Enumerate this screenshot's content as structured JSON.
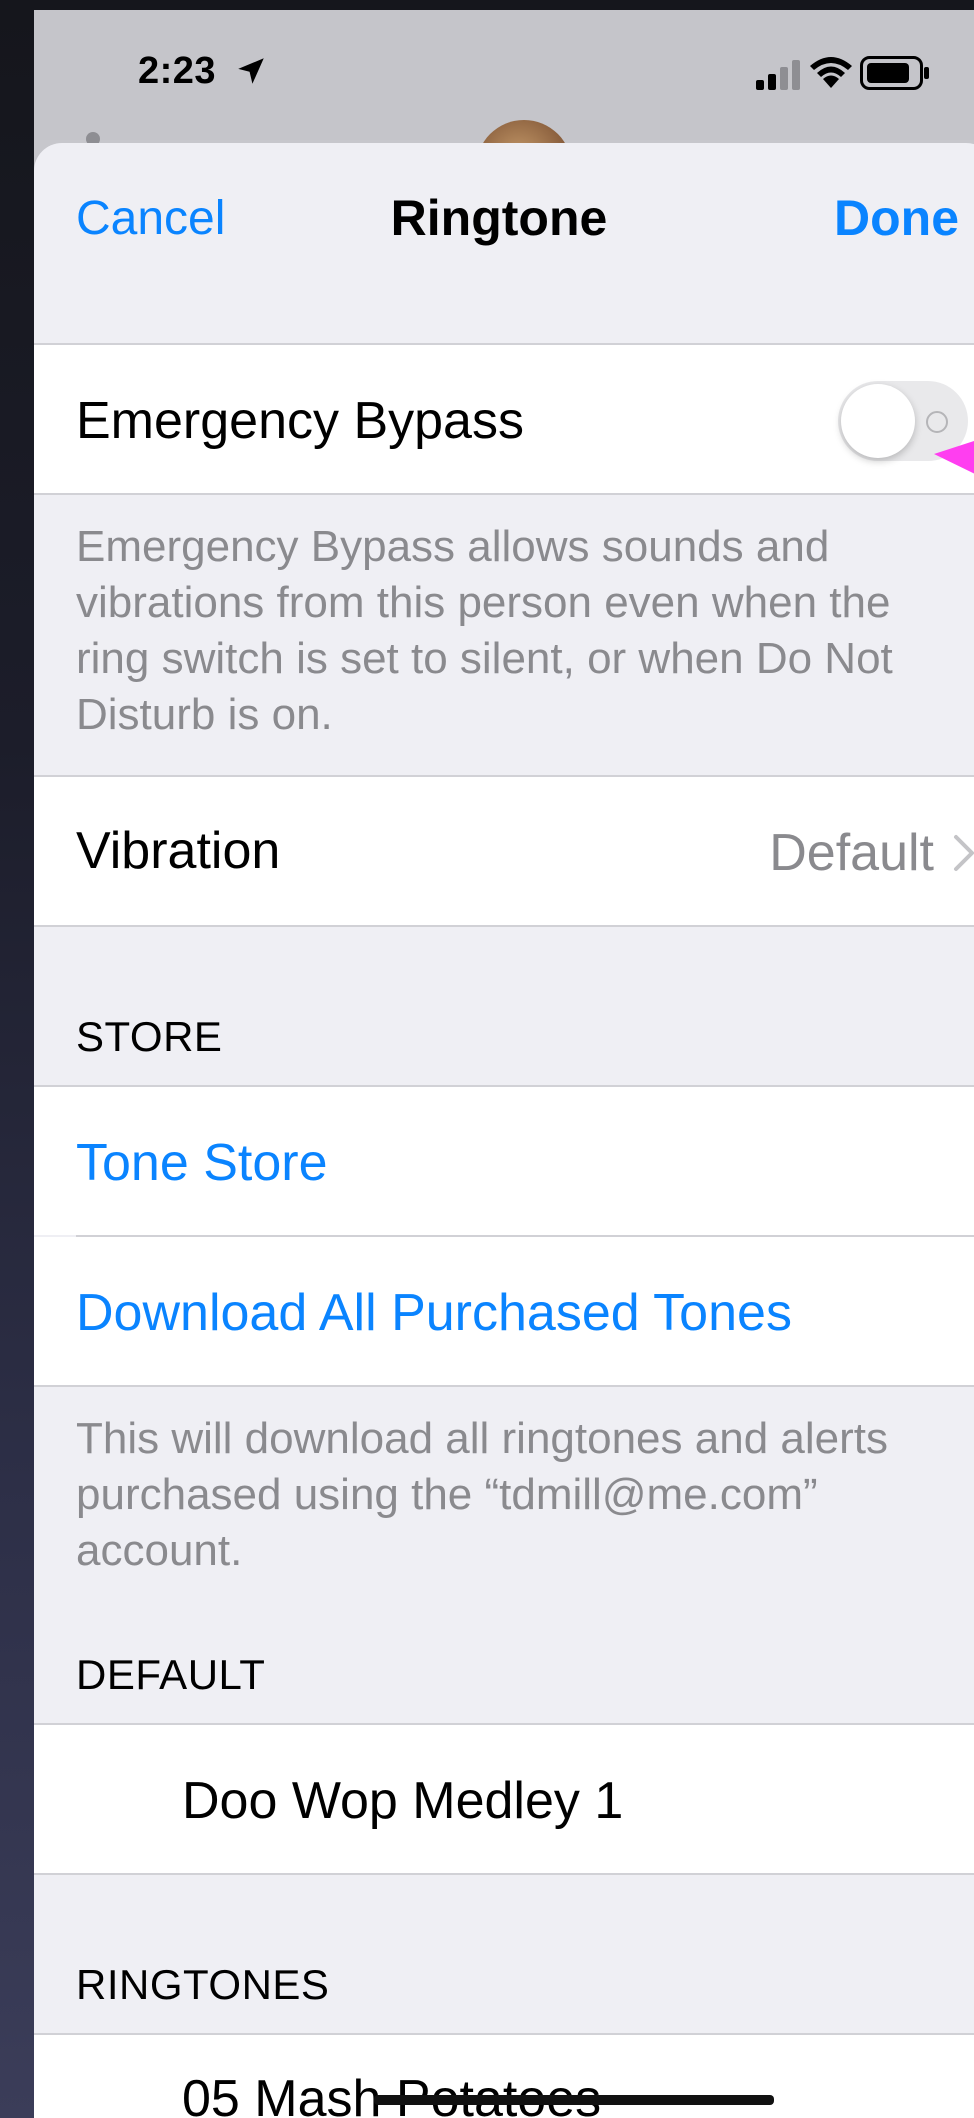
{
  "status_bar": {
    "time": "2:23",
    "location_icon": "location-arrow-icon",
    "signal_icon": "cellular-signal-icon",
    "wifi_icon": "wifi-icon",
    "battery_icon": "battery-icon"
  },
  "nav": {
    "cancel": "Cancel",
    "title": "Ringtone",
    "done": "Done"
  },
  "emergency_bypass": {
    "label": "Emergency Bypass",
    "enabled": false,
    "footer": "Emergency Bypass allows sounds and vibrations from this person even when the ring switch is set to silent, or when Do Not Disturb is on."
  },
  "vibration": {
    "label": "Vibration",
    "value": "Default"
  },
  "store": {
    "header": "STORE",
    "tone_store": "Tone Store",
    "download_all": "Download All Purchased Tones",
    "footer": "This will download all ringtones and alerts purchased using the “tdmill@me.com” account."
  },
  "default_section": {
    "header": "DEFAULT",
    "tone": "Doo Wop Medley 1"
  },
  "ringtones": {
    "header": "RINGTONES",
    "first_item": "05 Mash Potatoes"
  },
  "colors": {
    "accent": "#0a84ff",
    "annotation_arrow": "#ff3ef0",
    "sheet_background": "#efeff4"
  }
}
